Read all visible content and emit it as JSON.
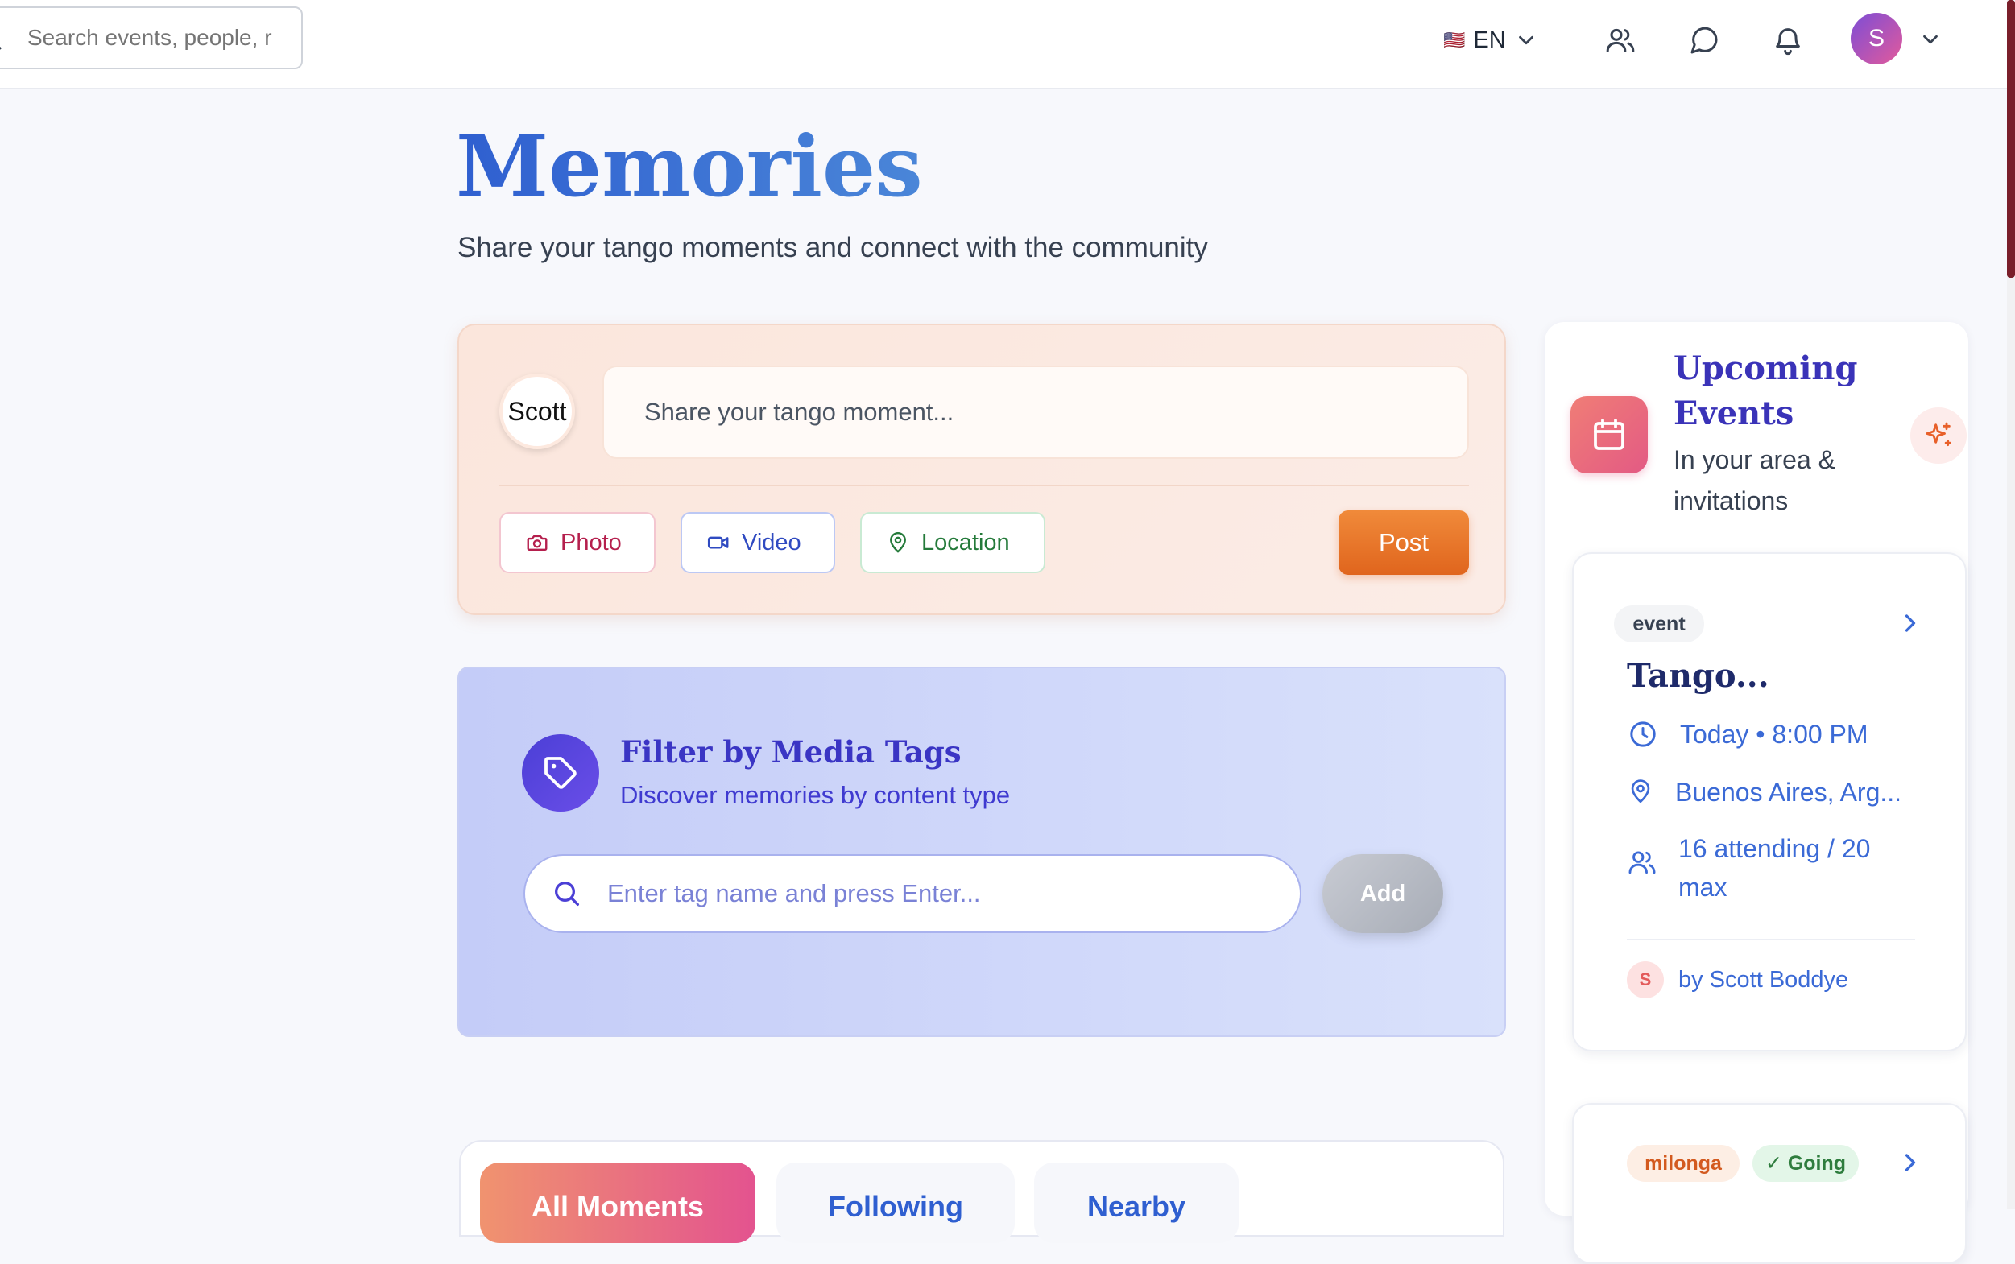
{
  "topbar": {
    "search_placeholder": "Search events, people, r",
    "language": "EN",
    "avatar_letter": "S"
  },
  "page": {
    "title": "Memories",
    "subtitle": "Share your tango moments and connect with the community"
  },
  "composer": {
    "avatar_alt": "Scott",
    "placeholder": "Share your tango moment...",
    "photo_label": "Photo",
    "video_label": "Video",
    "location_label": "Location",
    "post_label": "Post"
  },
  "tag_filter": {
    "title": "Filter by Media Tags",
    "subtitle": "Discover memories by content type",
    "input_placeholder": "Enter tag name and press Enter...",
    "add_label": "Add"
  },
  "tabs": [
    {
      "label": "All Moments",
      "active": true
    },
    {
      "label": "Following",
      "active": false
    },
    {
      "label": "Nearby",
      "active": false
    }
  ],
  "sidebar": {
    "title": "Upcoming Events",
    "subtitle": "In your area & invitations",
    "events": [
      {
        "chip": "event",
        "title": "Tango...",
        "time": "Today • 8:00 PM",
        "location": "Buenos Aires, Arg...",
        "attendance": "16 attending / 20 max",
        "organizer_initial": "S",
        "organizer": "by Scott Boddye"
      },
      {
        "chip": "milonga",
        "status": "✓ Going"
      }
    ]
  },
  "colors": {
    "accent_blue": "#2f5fd0",
    "post_orange": "#e0651d",
    "tag_purple": "#4b3fd6",
    "events_pink": "#e35a84"
  }
}
